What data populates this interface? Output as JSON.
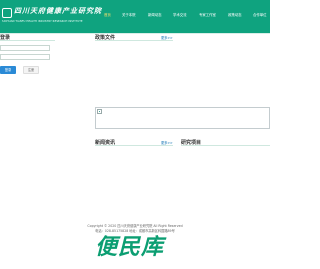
{
  "header": {
    "title": "四川天府健康产业研究院",
    "subtitle": "SICHUAN TIANFU HEALTH INDUSTRY RESEARCH INSTITUTE",
    "nav": [
      {
        "label": "首页",
        "active": true
      },
      {
        "label": "关于本院",
        "active": false
      },
      {
        "label": "新闻动态",
        "active": false
      },
      {
        "label": "学术交流",
        "active": false
      },
      {
        "label": "专家工作室",
        "active": false
      },
      {
        "label": "政策动态",
        "active": false
      },
      {
        "label": "合作单位",
        "active": false
      }
    ]
  },
  "login": {
    "title": "登录",
    "login_button": "登录",
    "register_button": "注册"
  },
  "policy": {
    "title": "政策文件",
    "more": "更多>>"
  },
  "news": {
    "title": "新闻资讯",
    "more": "更多>>"
  },
  "projects": {
    "title": "研究项目"
  },
  "footer": {
    "copyright": "Copyright © 2020 四川天府健康产业研究院 All Right Reserved",
    "contact": "电话：028-85175828  地址：成都市高新区科园路89号",
    "watermark": "便民库"
  },
  "colors": {
    "primary": "#0fa37f",
    "accent_button": "#2a8ad6",
    "link": "#0c6fb3"
  }
}
